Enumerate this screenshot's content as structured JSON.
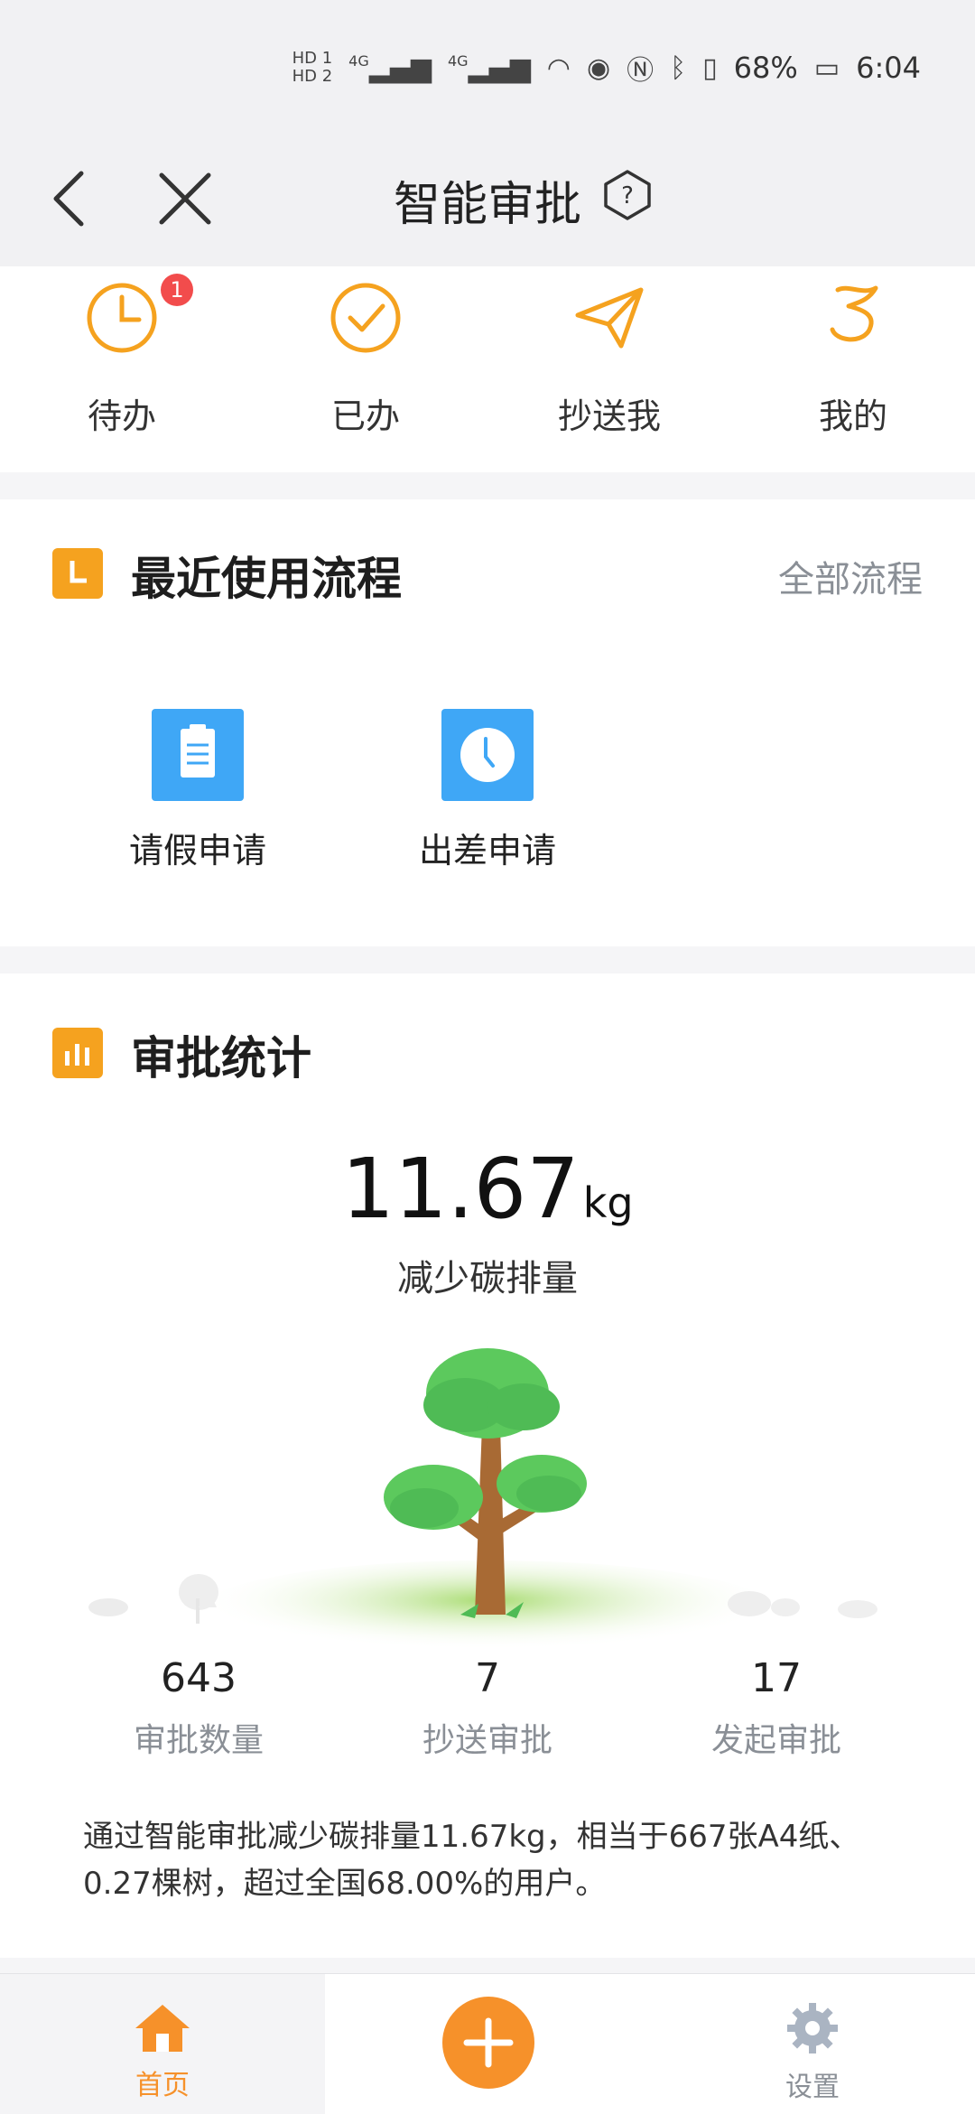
{
  "status_bar": {
    "battery_percent": "68%",
    "time": "6:04",
    "network_1": "4G",
    "network_2": "4G",
    "sim_1": "HD 1",
    "sim_2": "HD 2"
  },
  "nav": {
    "title": "智能审批",
    "icons": [
      "back-icon",
      "close-icon",
      "help-icon"
    ]
  },
  "quick_actions": [
    {
      "label": "待办",
      "icon": "clock-icon",
      "badge": "1"
    },
    {
      "label": "已办",
      "icon": "check-circle-icon"
    },
    {
      "label": "抄送我",
      "icon": "paper-plane-icon"
    },
    {
      "label": "我的",
      "icon": "flag-icon"
    }
  ],
  "recent": {
    "title": "最近使用流程",
    "all_link": "全部流程",
    "items": [
      {
        "label": "请假申请",
        "icon": "clipboard-icon"
      },
      {
        "label": "出差申请",
        "icon": "clock-icon"
      }
    ]
  },
  "stats": {
    "title": "审批统计",
    "carbon_value": "11.67",
    "carbon_unit": "kg",
    "carbon_caption": "减少碳排量",
    "columns": [
      {
        "value": "643",
        "label": "审批数量"
      },
      {
        "value": "7",
        "label": "抄送审批"
      },
      {
        "value": "17",
        "label": "发起审批"
      }
    ],
    "summary": "通过智能审批减少碳排量11.67kg，相当于667张A4纸、0.27棵树，超过全国68.00%的用户。"
  },
  "tabbar": {
    "home_label": "首页",
    "settings_label": "设置"
  },
  "colors": {
    "accent": "#f5a21f",
    "blue_tile": "#3fa7f6",
    "badge": "#f24c4c"
  }
}
